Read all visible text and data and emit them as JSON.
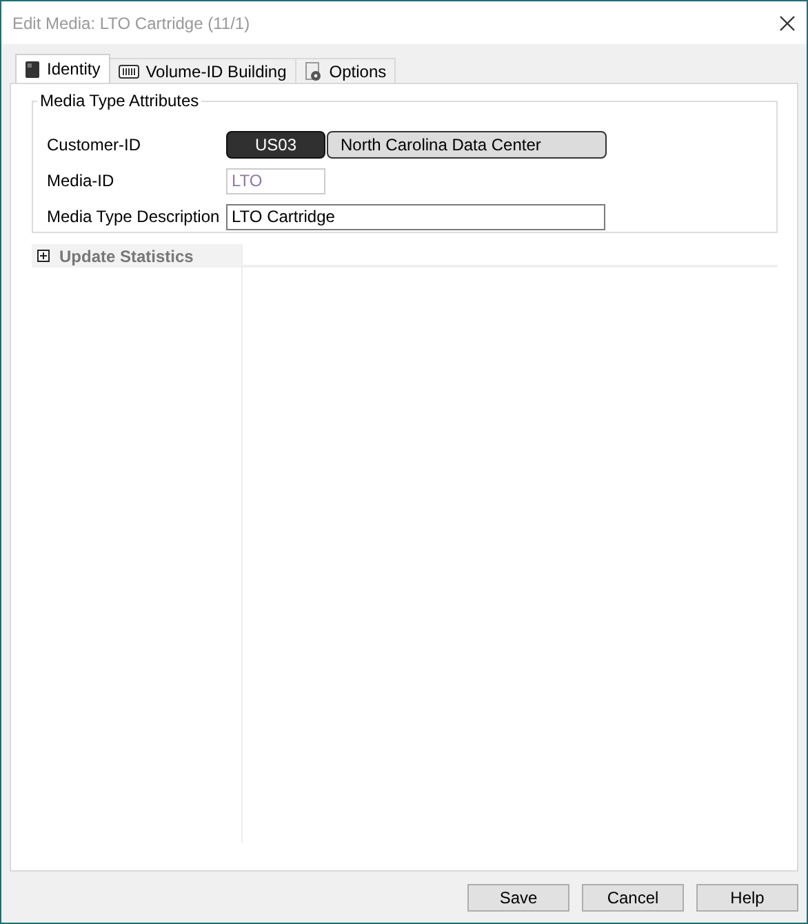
{
  "window": {
    "title": "Edit Media: LTO Cartridge (11/1)"
  },
  "tabs": [
    {
      "label": "Identity",
      "selected": true,
      "kind": "cartridge"
    },
    {
      "label": "Volume-ID Building",
      "selected": false,
      "kind": "barcode"
    },
    {
      "label": "Options",
      "selected": false,
      "kind": "gear"
    }
  ],
  "group": {
    "title": "Media Type Attributes",
    "fields": [
      {
        "label": "Customer-ID",
        "kind": "customer",
        "code": "US03",
        "name": "North Carolina Data Center"
      },
      {
        "label": "Media-ID",
        "kind": "text",
        "value": "LTO",
        "disabled": true
      },
      {
        "label": "Media Type Description",
        "kind": "text",
        "value": "LTO Cartridge",
        "disabled": false
      }
    ]
  },
  "section": {
    "title": "Update Statistics",
    "expanded": false
  },
  "buttons": [
    "Save",
    "Cancel",
    "Help"
  ]
}
